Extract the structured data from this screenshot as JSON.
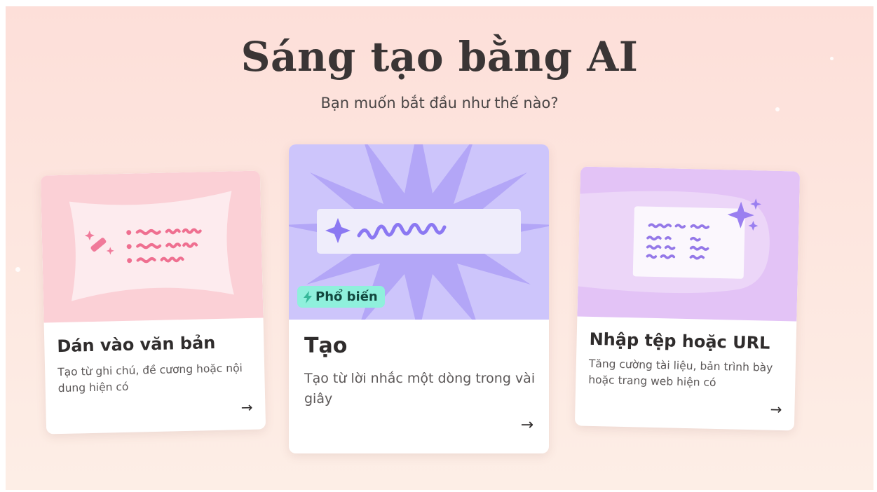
{
  "page": {
    "title": "Sáng tạo bằng AI",
    "subtitle": "Bạn muốn bắt đầu như thế nào?"
  },
  "cards": [
    {
      "title": "Dán vào văn bản",
      "description": "Tạo từ ghi chú, đề cương hoặc nội dung hiện có",
      "arrow": "→"
    },
    {
      "title": "Tạo",
      "description": "Tạo từ lời nhắc một dòng trong vài giây",
      "badge": "Phổ biến",
      "arrow": "→"
    },
    {
      "title": "Nhập tệp hoặc URL",
      "description": "Tăng cường tài liệu, bản trình bày hoặc trang web hiện có",
      "arrow": "→"
    }
  ],
  "colors": {
    "background": "#fde3dc",
    "paste_card_accent": "#fbd0d6",
    "generate_card_accent": "#cdc5fb",
    "import_card_accent": "#e3c3f6",
    "badge": "#8ff0dc"
  },
  "icons": [
    "magic-wand-icon",
    "sparkle-icon",
    "lightning-icon",
    "arrow-right-icon"
  ]
}
